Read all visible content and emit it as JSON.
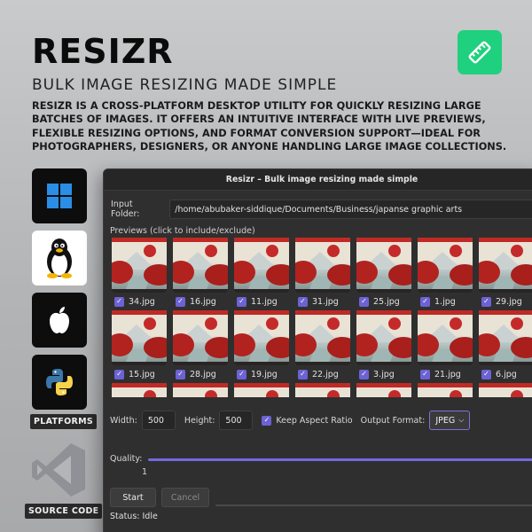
{
  "brand": {
    "title": "RESIZR",
    "subtitle": "BULK IMAGE RESIZING MADE SIMPLE",
    "description": "RESIZR IS A CROSS-PLATFORM DESKTOP UTILITY FOR QUICKLY RESIZING LARGE BATCHES OF IMAGES. IT OFFERS AN INTUITIVE INTERFACE WITH LIVE PREVIEWS, FLEXIBLE RESIZING OPTIONS, AND FORMAT CONVERSION SUPPORT—IDEAL FOR PHOTOGRAPHERS, DESIGNERS, OR ANYONE HANDLING LARGE IMAGE COLLECTIONS.",
    "badge_icon": "ruler-icon",
    "badge_color": "#1fd07e"
  },
  "platforms": {
    "items": [
      "windows-icon",
      "linux-tux-icon",
      "apple-icon",
      "python-icon"
    ],
    "label": "PLATFORMS"
  },
  "source": {
    "icon": "visual-studio-code-icon",
    "label": "SOURCE CODE"
  },
  "window": {
    "title": "Resizr – Bulk image resizing made simple",
    "input_folder_label": "Input Folder:",
    "input_folder_value": "/home/abubaker-siddique/Documents/Business/japanse graphic arts",
    "previews_label": "Previews (click to include/exclude)",
    "thumbnails_row1": [
      "34.jpg",
      "16.jpg",
      "11.jpg",
      "31.jpg",
      "25.jpg",
      "1.jpg",
      "29.jpg"
    ],
    "thumbnails_row2": [
      "15.jpg",
      "28.jpg",
      "19.jpg",
      "22.jpg",
      "3.jpg",
      "21.jpg",
      "6.jpg"
    ],
    "width_label": "Width:",
    "width_value": "500",
    "height_label": "Height:",
    "height_value": "500",
    "keep_aspect_label": "Keep Aspect Ratio",
    "keep_aspect_checked": true,
    "output_format_label": "Output Format:",
    "output_format_value": "JPEG",
    "quality_label": "Quality:",
    "quality_value": "1",
    "start_label": "Start",
    "cancel_label": "Cancel",
    "status_text": "Status: Idle",
    "accent_color": "#6d62d4"
  }
}
